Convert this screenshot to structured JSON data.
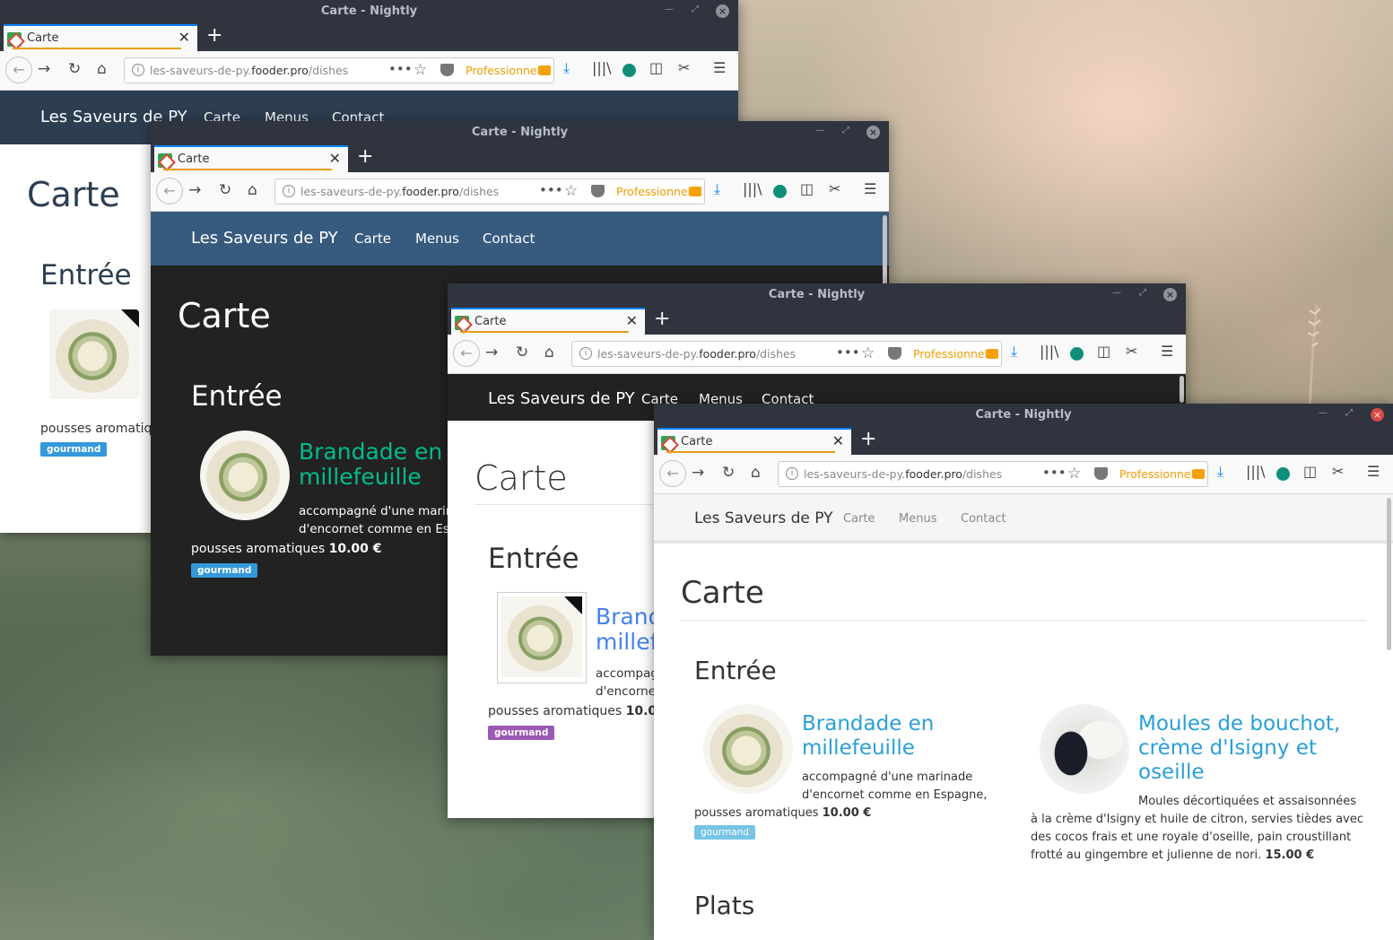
{
  "browser": {
    "window_title": "Carte - Nightly",
    "tab_label": "Carte",
    "url_prefix": "les-saveurs-de-py.",
    "url_domain": "fooder.pro",
    "url_path": "/dishes",
    "container_label": "Professionnel"
  },
  "site": {
    "brand": "Les Saveurs de PY",
    "nav": [
      "Carte",
      "Menus",
      "Contact"
    ],
    "page_title": "Carte",
    "section_entree": "Entrée",
    "section_plats": "Plats"
  },
  "dishes": [
    {
      "name": "Brandade en millefeuille",
      "name_line1": "Brandade en",
      "name_line2": "millefeuille",
      "desc_line1": "accompagné d'une marinade",
      "desc_line2": "d'encornet comme en Espagne,",
      "desc_line3": "pousses aromatiques",
      "desc_line1_short": "accompagné d'une marina",
      "desc_line2_short": "d'encornet comme en Esp",
      "desc_line1_tiny": "accompag",
      "desc_line2_tiny": "d'encornet",
      "price": "10.00 €",
      "badge": "gourmand"
    },
    {
      "name_line1": "Moules de bouchot,",
      "name_line2": "crème d'Isigny et",
      "name_line3": "oseille",
      "desc_line1": "Moules décortiquées et assaisonnées",
      "desc_line2": "à la crème d'Isigny et huile de citron, servies tièdes avec",
      "desc_line3": "des cocos frais et une royale d'oseille, pain croustillant",
      "desc_line4": "frotté au gingembre et julienne de nori.",
      "price": "15.00 €"
    }
  ],
  "themes": {
    "w1": {
      "nav_bg": "#2c3e50",
      "accent": "#18bc9c",
      "badge": "#3498db"
    },
    "w2": {
      "nav_bg": "#375a7f",
      "accent": "#00bc8c",
      "body_bg": "#222222",
      "badge": "#3498db"
    },
    "w3": {
      "nav_bg": "#222222",
      "accent": "#4582ec",
      "badge": "#9b59b6"
    },
    "w4": {
      "nav_bg": "#f5f5f5",
      "accent": "#2a9fd6",
      "badge": "#77c4e6"
    }
  },
  "icons": [
    "back-icon",
    "forward-icon",
    "reload-icon",
    "home-icon",
    "info-icon",
    "more-icon",
    "bookmark-star-icon",
    "pocket-icon",
    "briefcase-icon",
    "download-icon",
    "library-icon",
    "extension-icon",
    "sidebar-icon",
    "screenshot-icon",
    "menu-icon",
    "close-icon",
    "plus-icon"
  ]
}
